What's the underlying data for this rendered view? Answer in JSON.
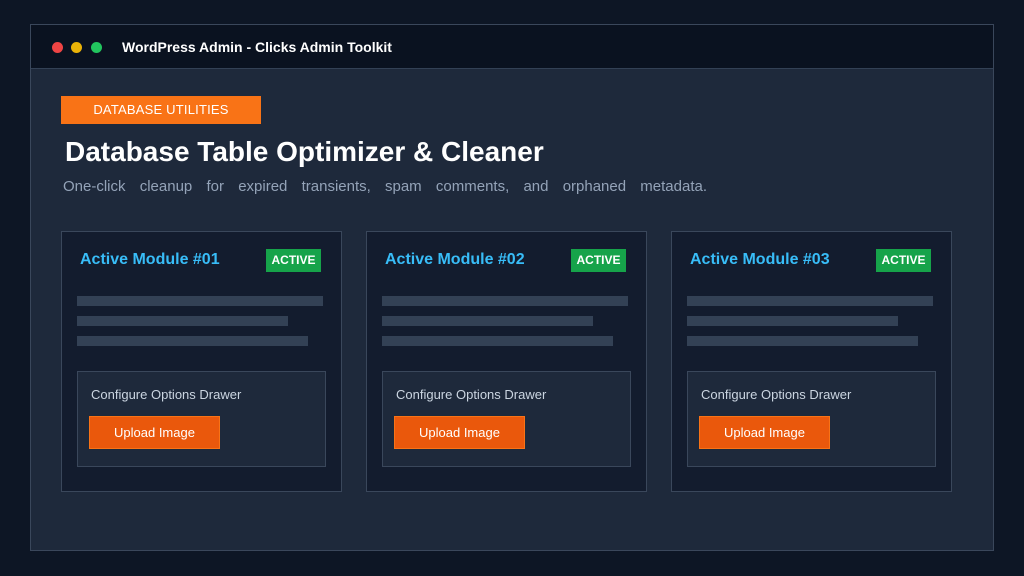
{
  "window": {
    "title": "WordPress Admin - Clicks Admin Toolkit",
    "controls": [
      "close",
      "minimize",
      "maximize"
    ]
  },
  "header": {
    "category": "DATABASE UTILITIES",
    "title": "Database Table Optimizer & Cleaner",
    "subtitle": "One-click cleanup for expired transients, spam comments, and orphaned metadata."
  },
  "cards": [
    {
      "title": "Active Module #01",
      "status": "ACTIVE",
      "drawer_label": "Configure Options Drawer",
      "button_label": "Upload Image"
    },
    {
      "title": "Active Module #02",
      "status": "ACTIVE",
      "drawer_label": "Configure Options Drawer",
      "button_label": "Upload Image"
    },
    {
      "title": "Active Module #03",
      "status": "ACTIVE",
      "drawer_label": "Configure Options Drawer",
      "button_label": "Upload Image"
    }
  ],
  "colors": {
    "page_background": "#0d1625",
    "window_background": "#1e293b",
    "titlebar_background": "#0a1220",
    "card_background": "#131c2e",
    "accent_orange": "#f97316",
    "button_orange": "#ea580c",
    "card_title_blue": "#38bdf8",
    "status_green": "#16a34a",
    "placeholder_gray": "#334155"
  }
}
